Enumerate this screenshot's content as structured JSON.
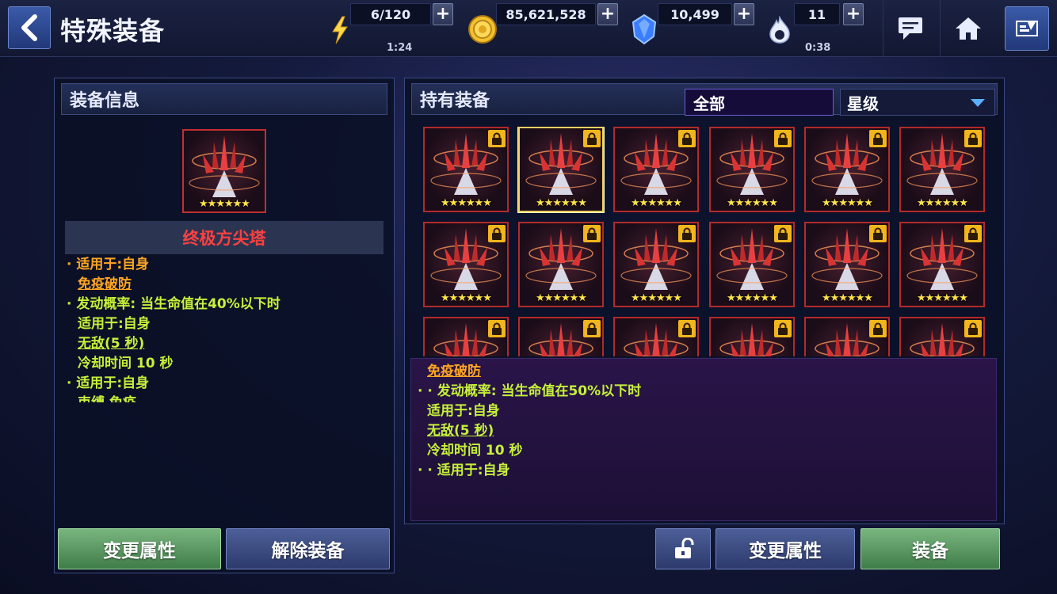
{
  "header": {
    "title": "特殊装备",
    "resources": {
      "energy": {
        "value": "6/120",
        "timer": "1:24"
      },
      "gold": {
        "value": "85,621,528"
      },
      "crystal": {
        "value": "10,499"
      },
      "flame": {
        "value": "11",
        "timer": "0:38"
      }
    },
    "plus": "+"
  },
  "left_panel": {
    "title": "装备信息",
    "item_name": "终极方尖塔",
    "item_stars": "★★★★★★",
    "desc_lines": [
      "· 适用于:自身",
      "免疫破防",
      "· 发动概率: 当生命值在40%以下时",
      "适用于:自身",
      "无敌(5 秒)",
      "冷却时间 10 秒",
      "· 适用于:自身",
      "束缚 免疫"
    ],
    "buttons": {
      "change": "变更属性",
      "unequip": "解除装备"
    }
  },
  "right_panel": {
    "title": "持有装备",
    "filter": "全部",
    "sort": "星级",
    "stars": "★★★★★★",
    "desc_lines": [
      "免疫破防",
      "· 发动概率: 当生命值在50%以下时",
      "适用于:自身",
      "无敌(5 秒)",
      "冷却时间 10 秒",
      "· 适用于:自身"
    ],
    "buttons": {
      "change": "变更属性",
      "equip": "装备"
    }
  },
  "colors": {
    "name_red": "#ff4040",
    "text_orange": "#ffa623",
    "text_green": "#c6f03a",
    "star_yellow": "#ffe34a"
  },
  "icons": [
    "back-arrow-icon",
    "lightning-icon",
    "gold-coin-icon",
    "crystal-icon",
    "flame-icon",
    "chat-icon",
    "home-icon",
    "menu-icon",
    "lock-icon",
    "unlock-icon",
    "dropdown-arrow-icon"
  ]
}
